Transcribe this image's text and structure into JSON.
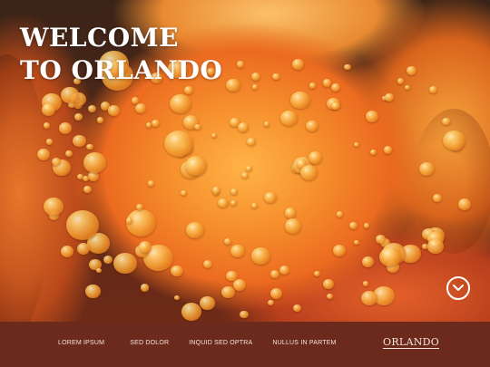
{
  "hero": {
    "title_line1": "WELCOME",
    "title_line2": "TO ORLANDO",
    "scroll_icon": "chevron-down-circle-icon"
  },
  "footer": {
    "nav": [
      {
        "label": "LOREM IPSUM"
      },
      {
        "label": "SED DOLOR"
      },
      {
        "label": "INQUID SED OPTRA"
      },
      {
        "label": "NULLUS IN PARTEM"
      }
    ],
    "logo": "ORLANDO"
  },
  "colors": {
    "footer_bg": "#6b2a1c",
    "title_text": "#ffffff",
    "petal_orange": "#f7922e"
  }
}
